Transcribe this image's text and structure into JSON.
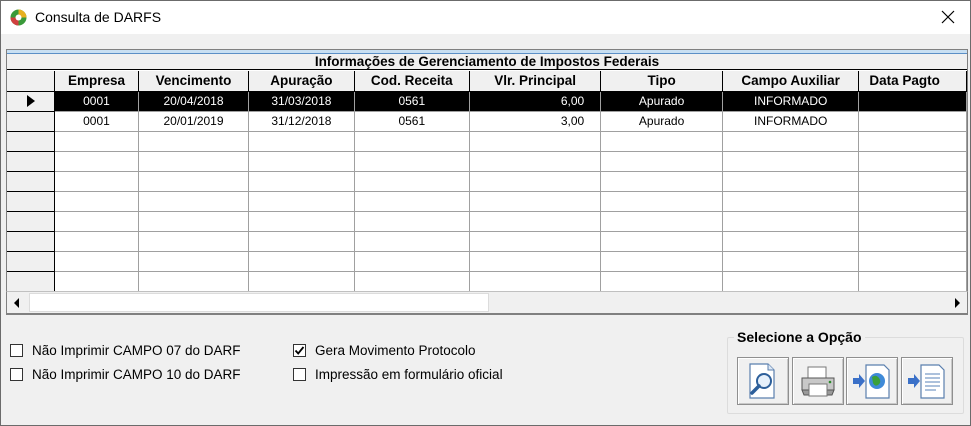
{
  "window": {
    "title": "Consulta de DARFS"
  },
  "grid": {
    "banner": "Informações de Gerenciamento de Impostos Federais",
    "columns": [
      "Empresa",
      "Vencimento",
      "Apuração",
      "Cod. Receita",
      "Vlr. Principal",
      "Tipo",
      "Campo Auxiliar",
      "Data Pagto"
    ],
    "rows": [
      [
        "0001",
        "20/04/2018",
        "31/03/2018",
        "0561",
        "6,00",
        "Apurado",
        "INFORMADO",
        ""
      ],
      [
        "0001",
        "20/01/2019",
        "31/12/2018",
        "0561",
        "3,00",
        "Apurado",
        "INFORMADO",
        ""
      ]
    ],
    "selected_row": 0,
    "empty_rows": 8
  },
  "options": {
    "nao_imprimir_07": {
      "label": "Não Imprimir CAMPO 07 do DARF",
      "checked": false
    },
    "nao_imprimir_10": {
      "label": "Não Imprimir CAMPO 10 do DARF",
      "checked": false
    },
    "gera_movimento": {
      "label": "Gera Movimento Protocolo",
      "checked": true
    },
    "formulario_oficial": {
      "label": "Impressão em formulário oficial",
      "checked": false
    }
  },
  "select_group": {
    "label": "Selecione a Opção",
    "buttons": [
      "preview-icon",
      "printer-icon",
      "export-web-icon",
      "export-document-icon"
    ]
  },
  "colors": {
    "selected_row_bg": "#000000",
    "banner_stripe": "#c8dff2"
  }
}
